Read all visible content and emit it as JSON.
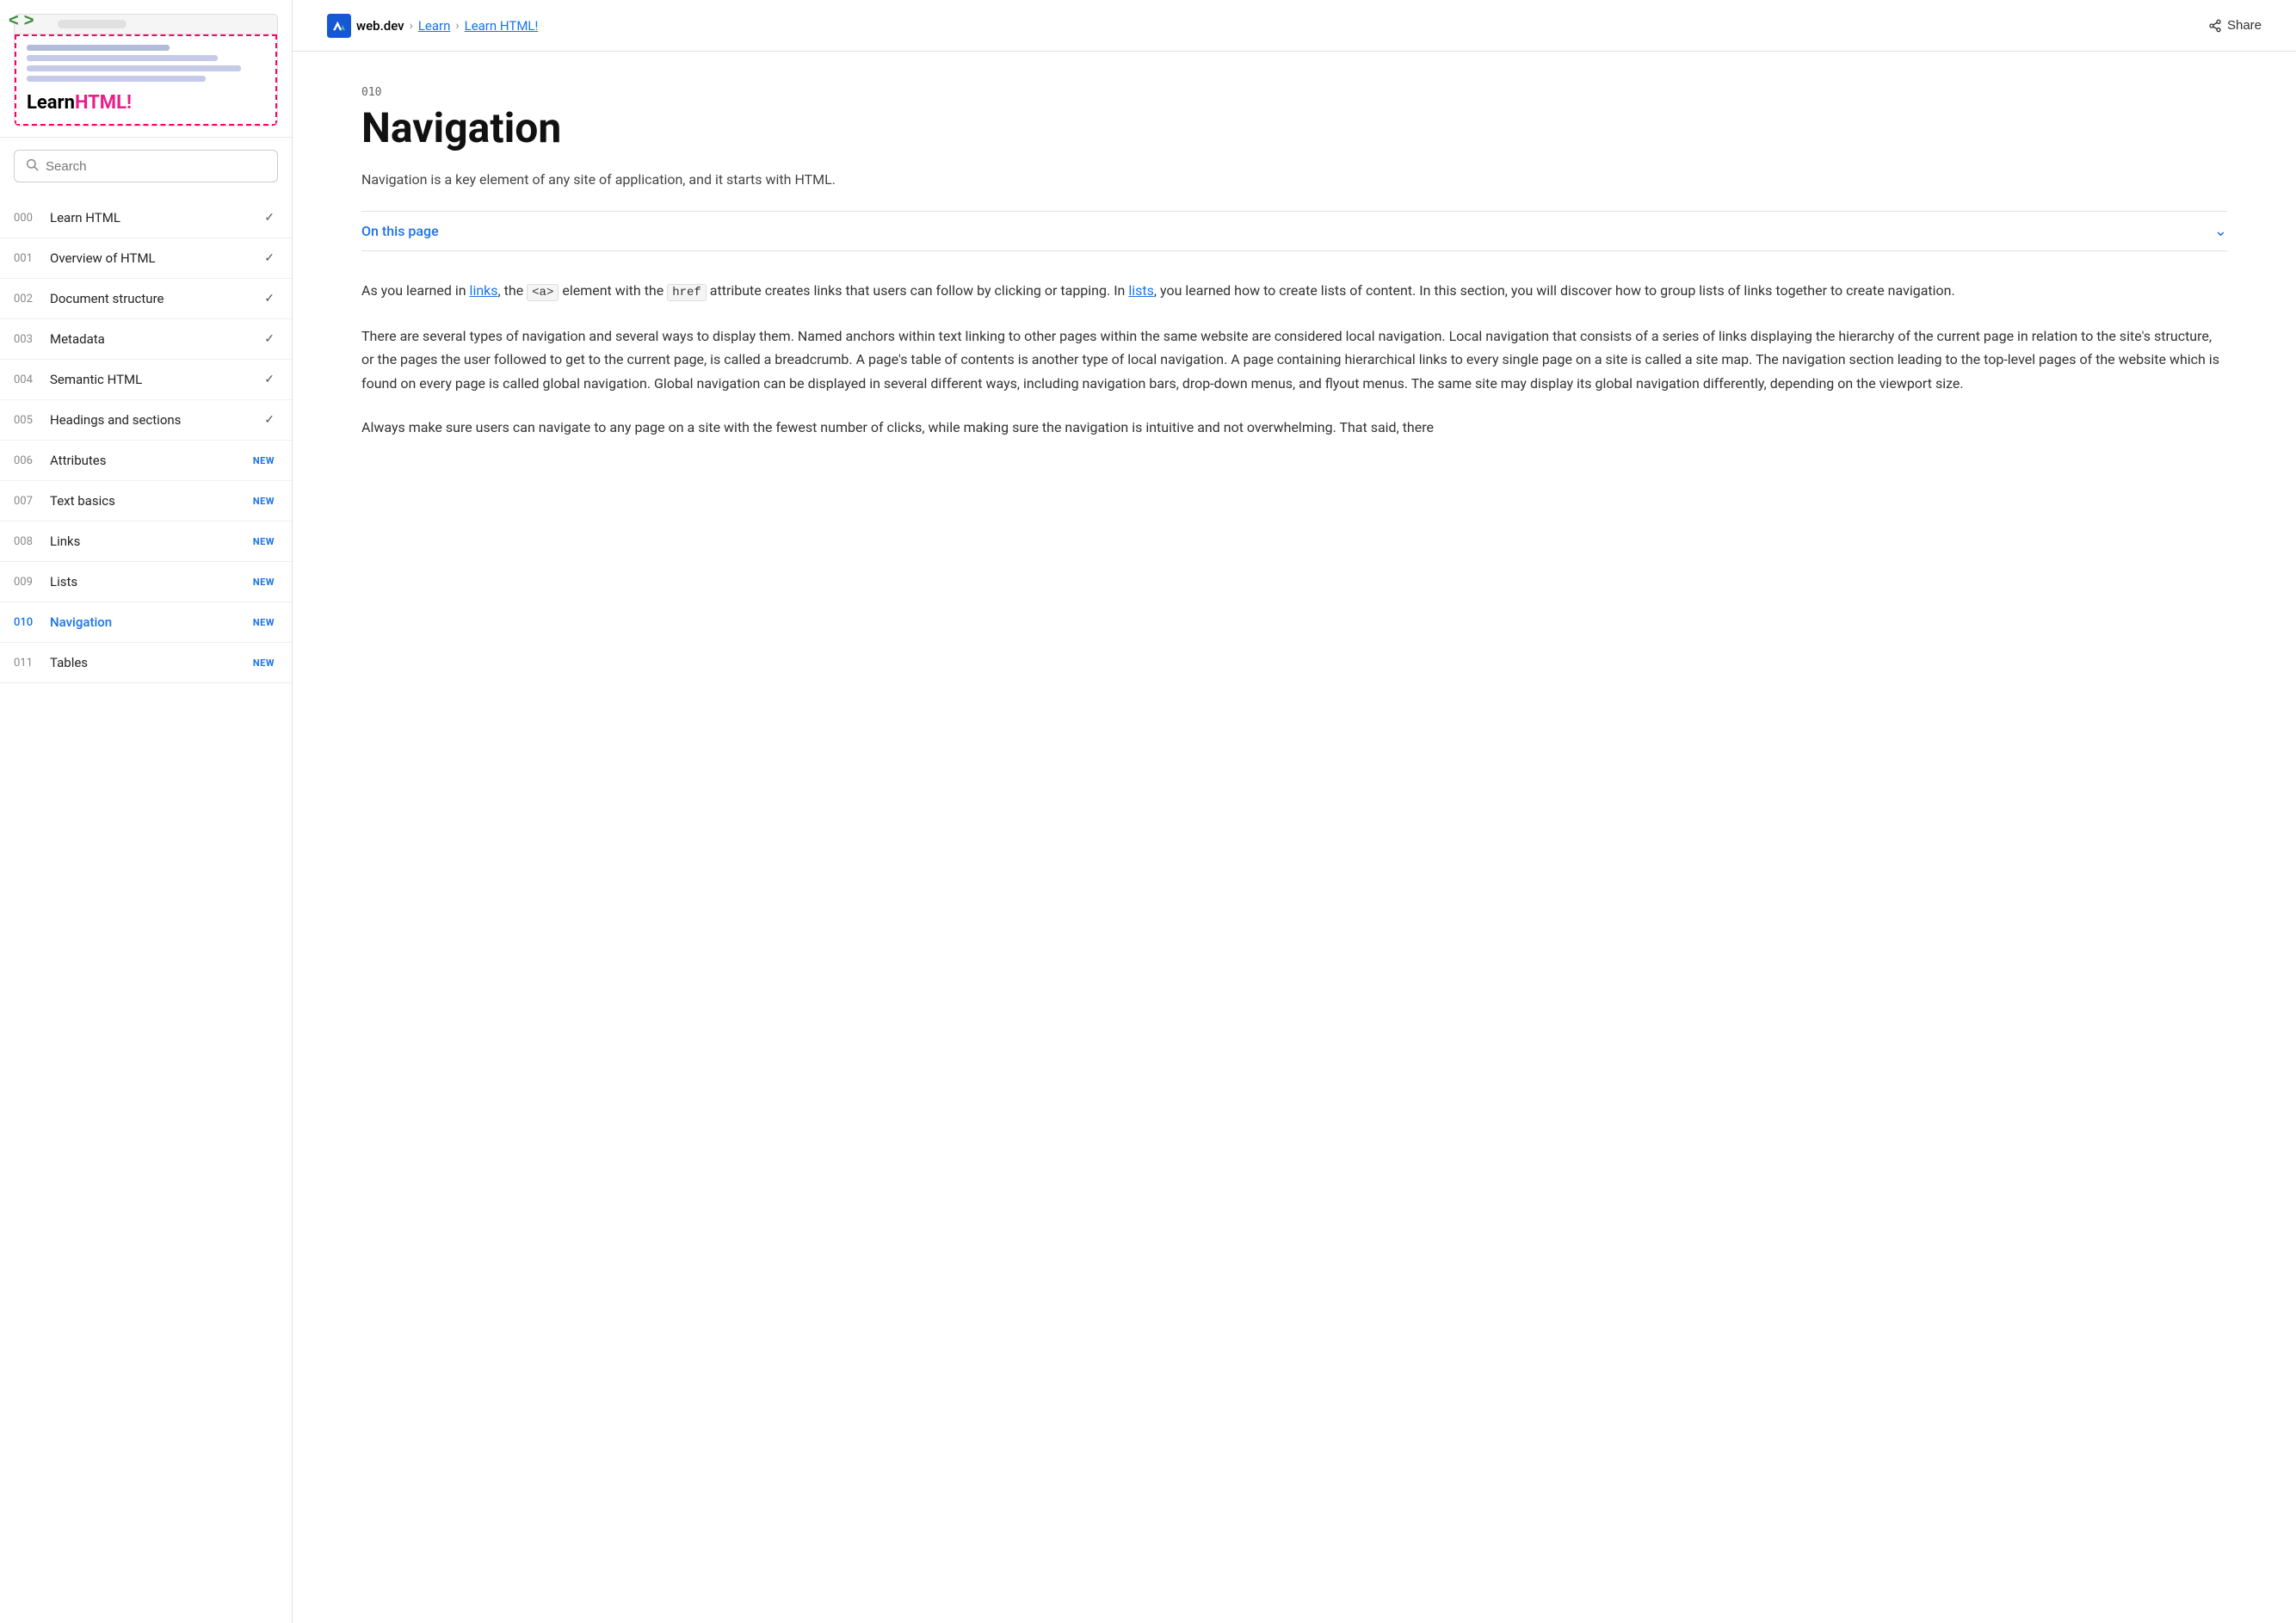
{
  "sidebar": {
    "logo": {
      "learn_text": "Learn",
      "html_text": "HTML!",
      "exclaim": "!"
    },
    "search": {
      "placeholder": "Search"
    },
    "nav_items": [
      {
        "num": "000",
        "label": "Learn HTML",
        "badge": "check",
        "active": false
      },
      {
        "num": "001",
        "label": "Overview of HTML",
        "badge": "check",
        "active": false
      },
      {
        "num": "002",
        "label": "Document structure",
        "badge": "check",
        "active": false
      },
      {
        "num": "003",
        "label": "Metadata",
        "badge": "check",
        "active": false
      },
      {
        "num": "004",
        "label": "Semantic HTML",
        "badge": "check",
        "active": false
      },
      {
        "num": "005",
        "label": "Headings and sections",
        "badge": "check",
        "active": false
      },
      {
        "num": "006",
        "label": "Attributes",
        "badge": "new",
        "active": false
      },
      {
        "num": "007",
        "label": "Text basics",
        "badge": "new",
        "active": false
      },
      {
        "num": "008",
        "label": "Links",
        "badge": "new",
        "active": false
      },
      {
        "num": "009",
        "label": "Lists",
        "badge": "new",
        "active": false
      },
      {
        "num": "010",
        "label": "Navigation",
        "badge": "new",
        "active": true
      },
      {
        "num": "011",
        "label": "Tables",
        "badge": "new",
        "active": false
      }
    ]
  },
  "topbar": {
    "site_name": "web.dev",
    "breadcrumb_sep1": ">",
    "breadcrumb_learn": "Learn",
    "breadcrumb_sep2": ">",
    "breadcrumb_current": "Learn HTML!",
    "share_label": "Share"
  },
  "content": {
    "page_number": "010",
    "page_title": "Navigation",
    "page_subtitle": "Navigation is a key element of any site of application, and it starts with HTML.",
    "on_this_page_label": "On this page",
    "body1": {
      "prefix": "As you learned in ",
      "link1": "links",
      "mid1": ", the ",
      "code1": "<a>",
      "mid2": " element with the ",
      "code2": "href",
      "mid3": " attribute creates links that users can follow by clicking or tapping. In ",
      "link2": "lists",
      "suffix": ", you learned how to create lists of content. In this section, you will discover how to group lists of links together to create navigation."
    },
    "body2": "There are several types of navigation and several ways to display them. Named anchors within text linking to other pages within the same website are considered local navigation. Local navigation that consists of a series of links displaying the hierarchy of the current page in relation to the site's structure, or the pages the user followed to get to the current page, is called a breadcrumb. A page's table of contents is another type of local navigation. A page containing hierarchical links to every single page on a site is called a site map. The navigation section leading to the top-level pages of the website which is found on every page is called global navigation. Global navigation can be displayed in several different ways, including navigation bars, drop-down menus, and flyout menus. The same site may display its global navigation differently, depending on the viewport size.",
    "body3": "Always make sure users can navigate to any page on a site with the fewest number of clicks, while making sure the navigation is intuitive and not overwhelming. That said, there"
  }
}
